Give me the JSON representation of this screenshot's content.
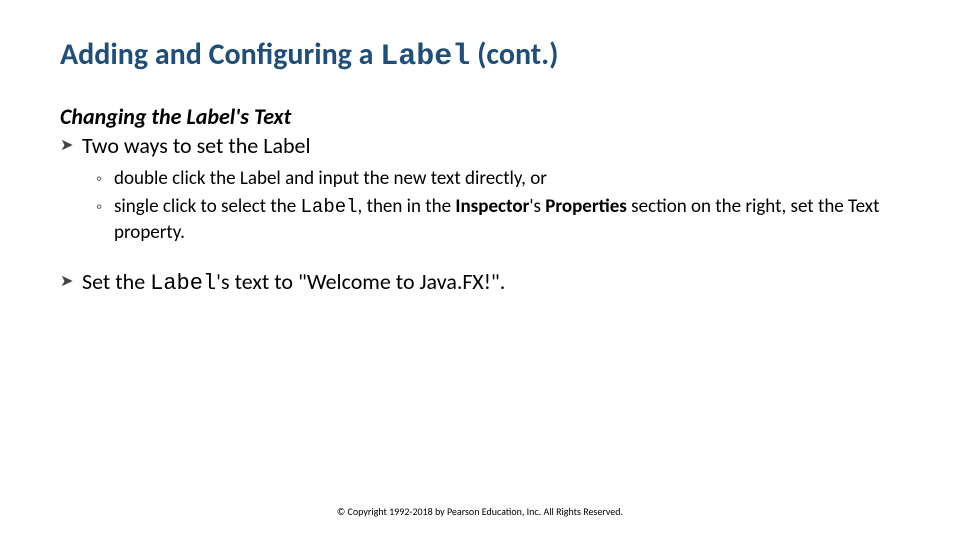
{
  "title": {
    "pre": "Adding and Configuring a ",
    "code": "Label",
    "post": " (cont.)"
  },
  "subheading": "Changing the Label's Text",
  "bullet1": "Two ways to set the Label",
  "sub1": "double click the Label and input the new text directly, or",
  "sub2": {
    "t1": "single click to select the ",
    "code": "Label",
    "t2": ", then in the ",
    "bold1": "Inspector",
    "t3": "'s ",
    "bold2": "Properties",
    "t4": " section on the right, set the Text property."
  },
  "bullet2": {
    "t1": "Set the ",
    "code": "Label",
    "t2": "'s text to \"Welcome to Java.FX!\"."
  },
  "copyright": "© Copyright 1992-2018 by Pearson Education, Inc. All Rights Reserved."
}
